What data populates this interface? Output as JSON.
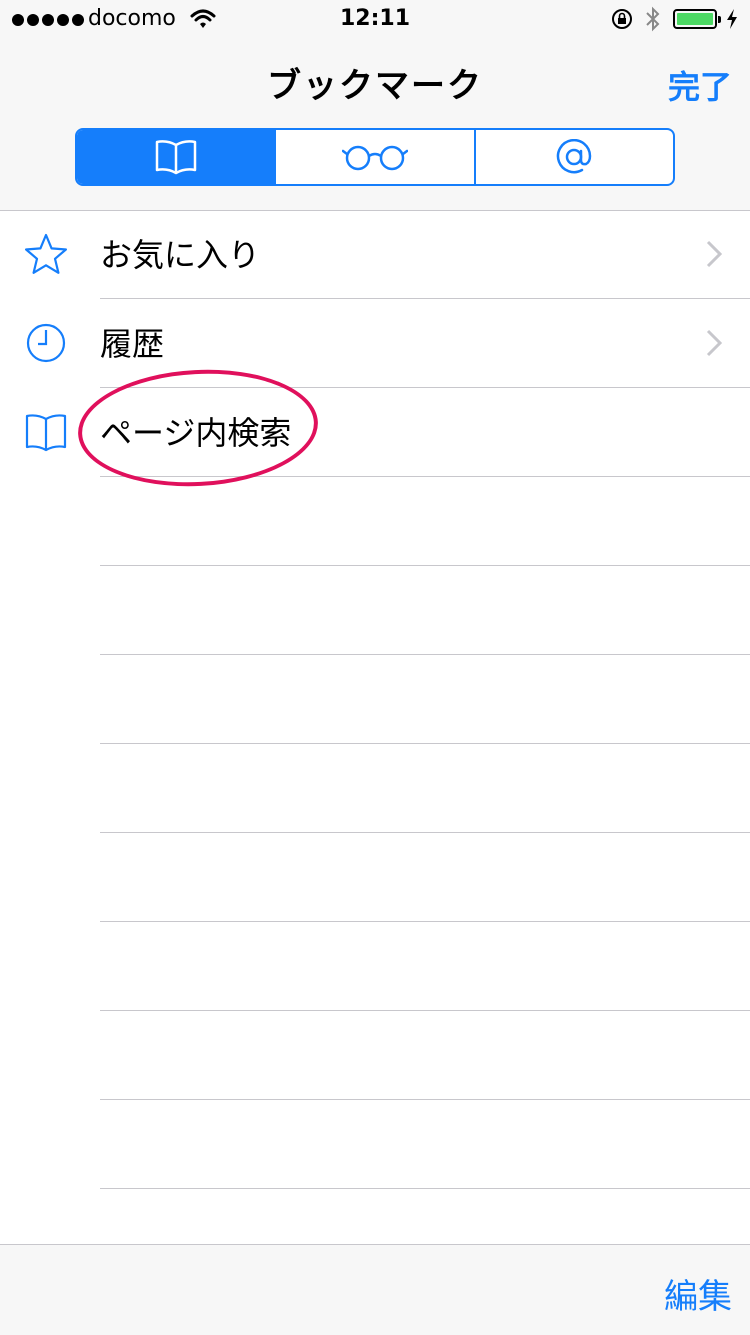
{
  "status_bar": {
    "carrier": "docomo",
    "time": "12:11",
    "battery_level": 1.0
  },
  "nav": {
    "title": "ブックマーク",
    "done_label": "完了"
  },
  "segments": [
    {
      "icon": "book-icon",
      "selected": true
    },
    {
      "icon": "glasses-icon",
      "selected": false
    },
    {
      "icon": "at-sign-icon",
      "selected": false
    }
  ],
  "list": {
    "items": [
      {
        "label": "お気に入り",
        "icon": "star-icon",
        "has_chevron": true
      },
      {
        "label": "履歴",
        "icon": "clock-icon",
        "has_chevron": true
      },
      {
        "label": "ページ内検索",
        "icon": "book-icon",
        "has_chevron": false
      }
    ]
  },
  "toolbar": {
    "edit_label": "編集"
  },
  "colors": {
    "accent": "#157efb",
    "highlight": "#e0105c",
    "battery": "#4cd964"
  }
}
